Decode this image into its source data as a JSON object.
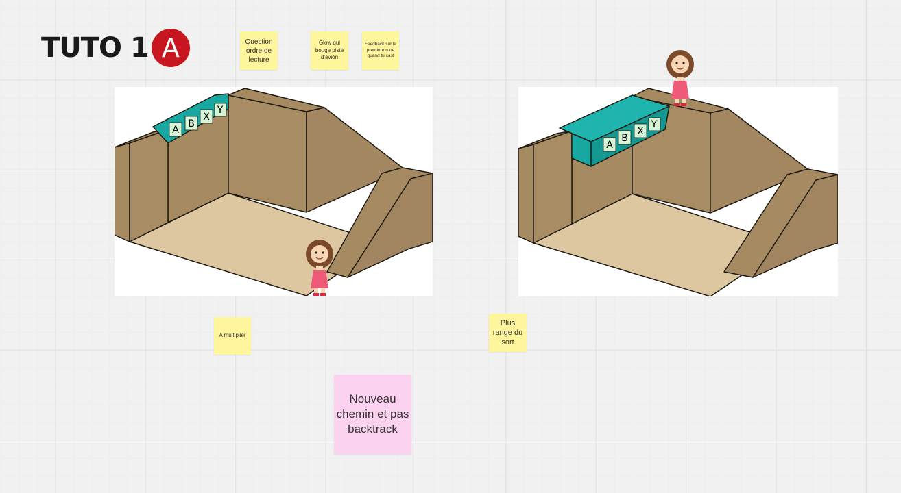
{
  "board": {
    "title_text": "TUTO 1",
    "title_badge": "A"
  },
  "stickies": [
    {
      "id": "question-ordre",
      "text": "Question ordre de lecture"
    },
    {
      "id": "glow-piste",
      "text": "Glow qui bouge piste d'avion"
    },
    {
      "id": "feedback-rune",
      "text": "Feedback sur la première rune quand tu cast"
    },
    {
      "id": "a-multiplier",
      "text": "A multiplier"
    },
    {
      "id": "plus-range",
      "text": "Plus range du sort"
    },
    {
      "id": "nouveau-chemin",
      "text": "Nouveau chemin et pas backtrack"
    }
  ],
  "scenes": {
    "left": {
      "runes": [
        "A",
        "B",
        "X",
        "Y"
      ]
    },
    "right": {
      "runes": [
        "A",
        "B",
        "X",
        "Y"
      ]
    }
  },
  "colors": {
    "wall": "#a68b62",
    "floor": "#dcc7a0",
    "teal": "#17a8a2",
    "rune_bg": "#d6f5d6",
    "sticky_yellow": "#fff59c",
    "sticky_pink": "#fbd3f0",
    "badge_red": "#c7161f"
  }
}
